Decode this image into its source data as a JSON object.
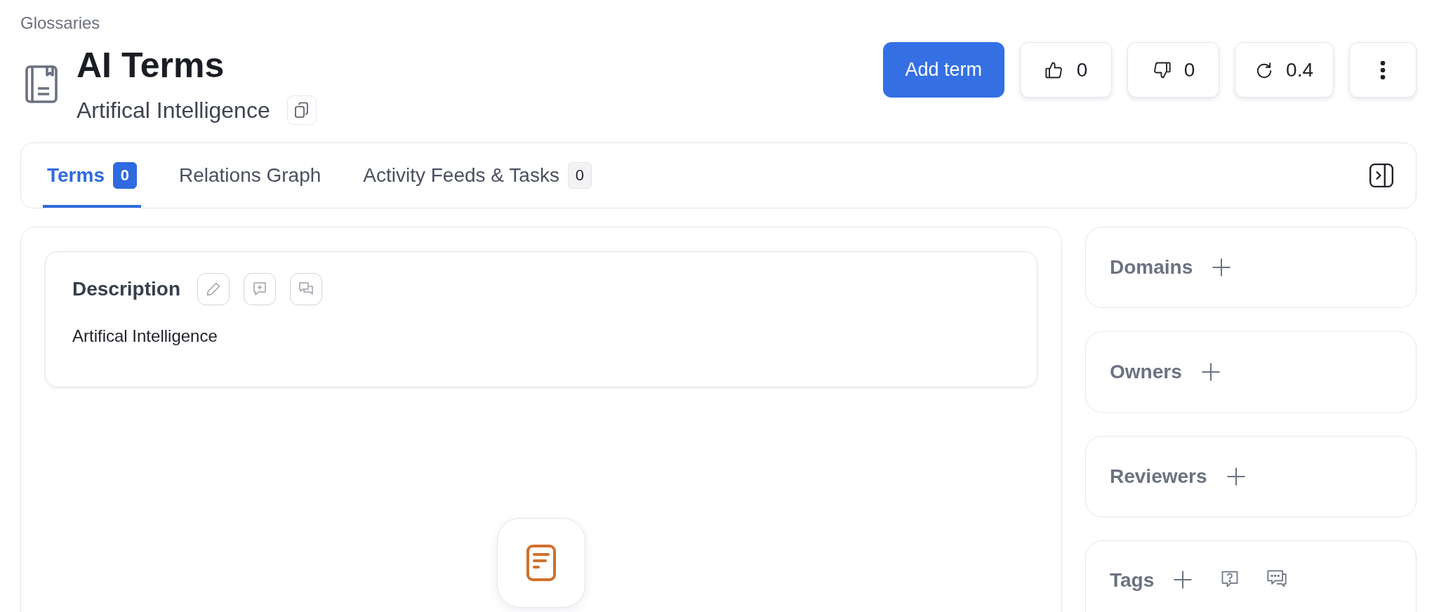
{
  "breadcrumb": "Glossaries",
  "title": "AI Terms",
  "subtitle": "Artifical Intelligence",
  "actions": {
    "add_button": "Add term",
    "likes": "0",
    "dislikes": "0",
    "version": "0.4"
  },
  "tabs": [
    {
      "label": "Terms",
      "count": "0",
      "selected": true
    },
    {
      "label": "Relations Graph",
      "selected": false
    },
    {
      "label": "Activity Feeds & Tasks",
      "count": "0",
      "selected": false
    }
  ],
  "description": {
    "heading": "Description",
    "text": "Artifical Intelligence"
  },
  "side_panels": [
    {
      "heading": "Domains",
      "kind": "plain"
    },
    {
      "heading": "Owners",
      "kind": "plain"
    },
    {
      "heading": "Reviewers",
      "kind": "plain"
    },
    {
      "heading": "Tags",
      "kind": "tags"
    }
  ]
}
